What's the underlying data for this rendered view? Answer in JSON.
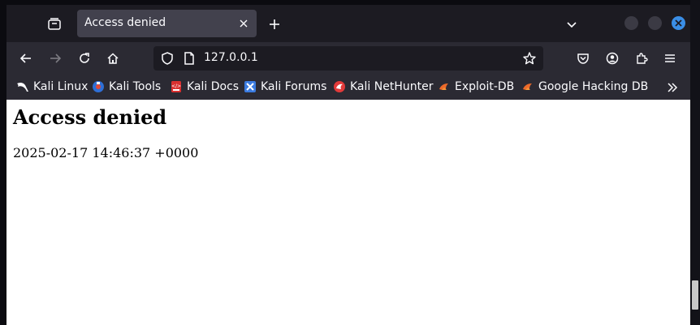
{
  "tab": {
    "title": "Access denied"
  },
  "navbar": {
    "url": "127.0.0.1"
  },
  "bookmarks": [
    {
      "label": "Kali Linux",
      "icon": "kali-dragon-icon"
    },
    {
      "label": "Kali Tools",
      "icon": "kali-tools-icon"
    },
    {
      "label": "Kali Docs",
      "icon": "kali-docs-icon"
    },
    {
      "label": "Kali Forums",
      "icon": "kali-forums-icon"
    },
    {
      "label": "Kali NetHunter",
      "icon": "kali-nethunter-icon"
    },
    {
      "label": "Exploit-DB",
      "icon": "exploit-db-icon"
    },
    {
      "label": "Google Hacking DB",
      "icon": "google-hacking-db-icon"
    }
  ],
  "page": {
    "heading": "Access denied",
    "timestamp": "2025-02-17 14:46:37 +0000"
  },
  "colors": {
    "tabbar_bg": "#1c1b22",
    "toolbar_bg": "#2b2a33",
    "active_tab_bg": "#42414d",
    "close_accent": "#3a8ee6",
    "page_bg": "#ffffff"
  }
}
